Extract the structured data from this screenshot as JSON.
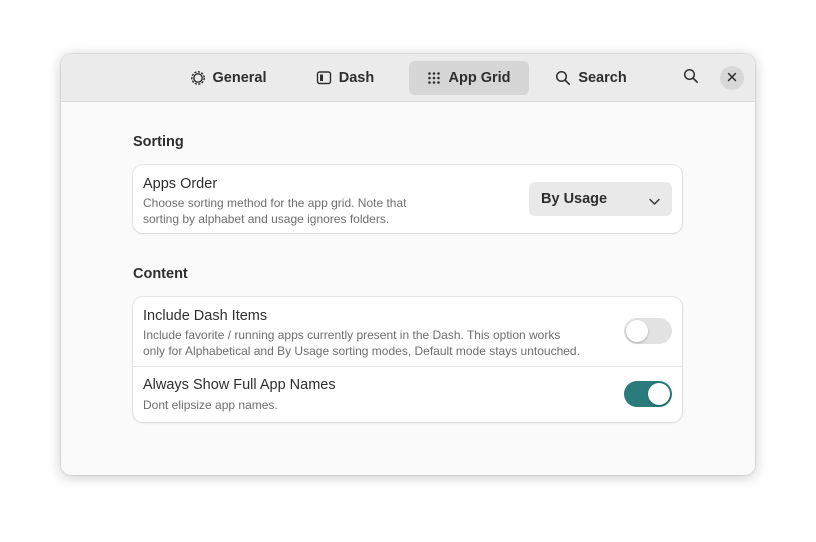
{
  "tabs": [
    {
      "label": "General",
      "icon": "gear-icon",
      "active": false
    },
    {
      "label": "Dash",
      "icon": "dash-icon",
      "active": false
    },
    {
      "label": "App Grid",
      "icon": "grid-icon",
      "active": true
    },
    {
      "label": "Search",
      "icon": "search-icon",
      "active": false
    }
  ],
  "header_buttons": {
    "search_icon": "search-icon",
    "close_icon": "close-icon"
  },
  "sections": {
    "sorting": {
      "title": "Sorting",
      "apps_order": {
        "title": "Apps Order",
        "subtitle_line1": "Choose sorting method for the app grid. Note that",
        "subtitle_line2": "sorting by alphabet and usage ignores folders.",
        "selected": "By Usage"
      }
    },
    "content": {
      "title": "Content",
      "include_dash": {
        "title": "Include Dash Items",
        "subtitle_line1": "Include favorite / running apps currently present in the Dash. This option works",
        "subtitle_line2": "only for Alphabetical and By Usage sorting modes, Default mode stays untouched.",
        "enabled": false
      },
      "full_names": {
        "title": "Always Show Full App Names",
        "subtitle": "Dont elipsize app names.",
        "enabled": true
      }
    }
  },
  "colors": {
    "accent": "#2a7b7b",
    "header_bg": "#ebebeb",
    "active_tab_bg": "#d6d6d6",
    "window_bg": "#fafafa"
  }
}
